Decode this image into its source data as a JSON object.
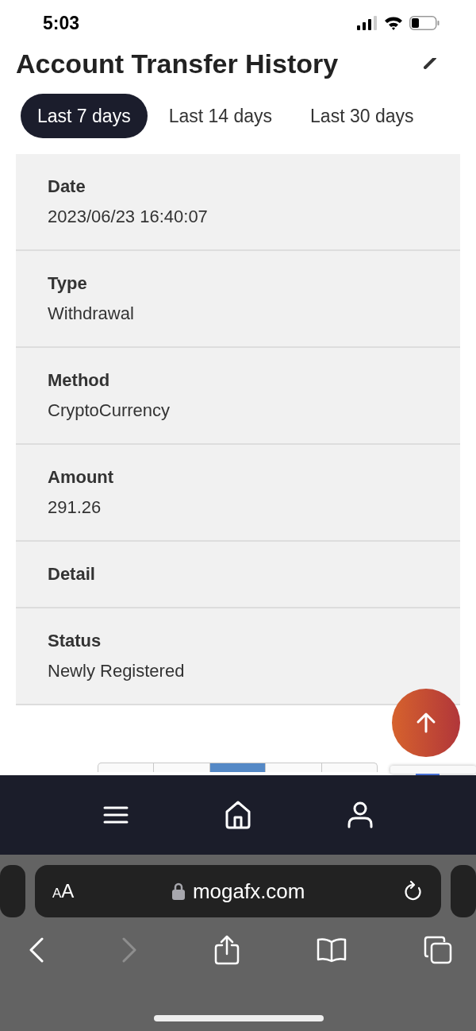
{
  "status_bar": {
    "time": "5:03"
  },
  "page_title": "Account Transfer History",
  "tabs": [
    {
      "label": "Last 7 days",
      "selected": true
    },
    {
      "label": "Last 14 days",
      "selected": false
    },
    {
      "label": "Last 30 days",
      "selected": false
    }
  ],
  "record": {
    "fields": [
      {
        "label": "Date",
        "value": "2023/06/23 16:40:07"
      },
      {
        "label": "Type",
        "value": "Withdrawal"
      },
      {
        "label": "Method",
        "value": "CryptoCurrency"
      },
      {
        "label": "Amount",
        "value": "291.26"
      },
      {
        "label": "Detail"
      },
      {
        "label": "Status",
        "value": "Newly Registered"
      }
    ]
  },
  "pagination": {
    "pages": [
      {
        "selected": false
      },
      {
        "selected": false
      },
      {
        "selected": true
      },
      {
        "selected": false
      },
      {
        "selected": false
      }
    ]
  },
  "browser": {
    "text_size_button": "AA",
    "url": "mogafx.com",
    "forward_disabled": true
  }
}
